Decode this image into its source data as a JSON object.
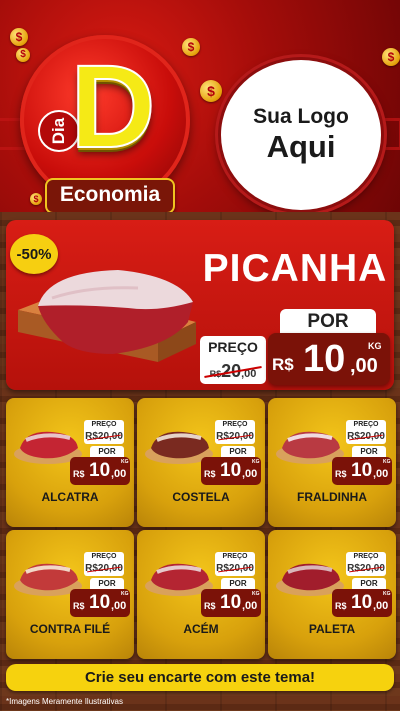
{
  "header": {
    "brand_dia": "Dia",
    "brand_d": "D",
    "brand_economia": "Economia",
    "logo_line1": "Sua Logo",
    "logo_line2": "Aqui",
    "coin_symbol": "$"
  },
  "hero": {
    "discount": "-50%",
    "name": "PICANHA",
    "por_label": "POR",
    "preco_label": "PREÇO",
    "old_currency": "R$",
    "old_int": "20",
    "old_dec": ",00",
    "new_currency": "R$",
    "new_int": "10",
    "new_dec": ",00",
    "unit": "KG"
  },
  "products": [
    {
      "name": "ALCATRA",
      "preco_label": "PREÇO",
      "old_price": "R$20,00",
      "por_label": "POR",
      "currency": "R$",
      "int": "10",
      "dec": ",00",
      "unit": "KG"
    },
    {
      "name": "COSTELA",
      "preco_label": "PREÇO",
      "old_price": "R$20,00",
      "por_label": "POR",
      "currency": "R$",
      "int": "10",
      "dec": ",00",
      "unit": "KG"
    },
    {
      "name": "FRALDINHA",
      "preco_label": "PREÇO",
      "old_price": "R$20,00",
      "por_label": "POR",
      "currency": "R$",
      "int": "10",
      "dec": ",00",
      "unit": "KG"
    },
    {
      "name": "CONTRA FILÉ",
      "preco_label": "PREÇO",
      "old_price": "R$20,00",
      "por_label": "POR",
      "currency": "R$",
      "int": "10",
      "dec": ",00",
      "unit": "KG"
    },
    {
      "name": "ACÉM",
      "preco_label": "PREÇO",
      "old_price": "R$20,00",
      "por_label": "POR",
      "currency": "R$",
      "int": "10",
      "dec": ",00",
      "unit": "KG"
    },
    {
      "name": "PALETA",
      "preco_label": "PREÇO",
      "old_price": "R$20,00",
      "por_label": "POR",
      "currency": "R$",
      "int": "10",
      "dec": ",00",
      "unit": "KG"
    }
  ],
  "footer": {
    "cta": "Crie seu encarte com este tema!",
    "disclaimer": "*Imagens Meramente Ilustrativas"
  },
  "colors": {
    "header_red": "#c9120c",
    "price_box": "#7b1208",
    "card_yellow": "#e6b010",
    "cta_yellow": "#f6d20e",
    "brand_yellow": "#f5ea16"
  }
}
